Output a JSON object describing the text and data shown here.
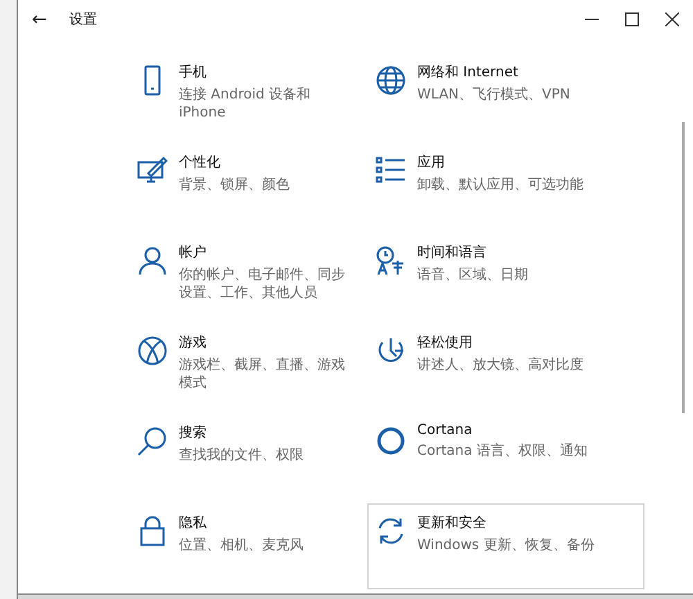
{
  "window": {
    "title": "设置",
    "back": "←"
  },
  "items": [
    {
      "kind": "phone",
      "title": "手机",
      "description": "连接 Android 设备和 iPhone",
      "highlighted": false
    },
    {
      "kind": "globe",
      "title": "网络和 Internet",
      "description": "WLAN、飞行模式、VPN",
      "highlighted": false
    },
    {
      "kind": "personalize",
      "title": "个性化",
      "description": "背景、锁屏、颜色",
      "highlighted": false
    },
    {
      "kind": "apps",
      "title": "应用",
      "description": "卸载、默认应用、可选功能",
      "highlighted": false
    },
    {
      "kind": "account",
      "title": "帐户",
      "description": "你的帐户、电子邮件、同步设置、工作、其他人员",
      "highlighted": false
    },
    {
      "kind": "time",
      "title": "时间和语言",
      "description": "语音、区域、日期",
      "highlighted": false
    },
    {
      "kind": "xbox",
      "title": "游戏",
      "description": "游戏栏、截屏、直播、游戏模式",
      "highlighted": false
    },
    {
      "kind": "ease",
      "title": "轻松使用",
      "description": "讲述人、放大镜、高对比度",
      "highlighted": false
    },
    {
      "kind": "search",
      "title": "搜索",
      "description": "查找我的文件、权限",
      "highlighted": false
    },
    {
      "kind": "cortana",
      "title": "Cortana",
      "description": "Cortana 语言、权限、通知",
      "highlighted": false
    },
    {
      "kind": "lock",
      "title": "隐私",
      "description": "位置、相机、麦克风",
      "highlighted": false
    },
    {
      "kind": "update",
      "title": "更新和安全",
      "description": "Windows 更新、恢复、备份",
      "highlighted": true
    }
  ]
}
